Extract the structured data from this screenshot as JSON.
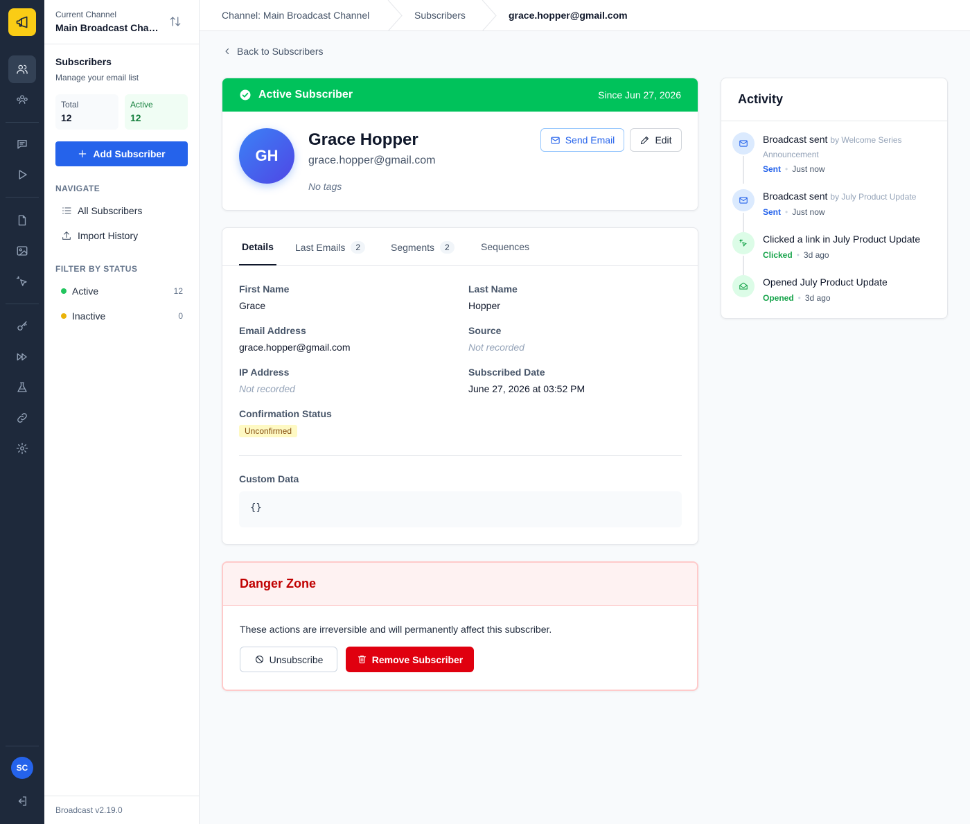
{
  "channel": {
    "label": "Current Channel",
    "name": "Main Broadcast Channel"
  },
  "sidebar": {
    "title": "Subscribers",
    "subtitle": "Manage your email list",
    "stats": {
      "total_label": "Total",
      "total_value": "12",
      "active_label": "Active",
      "active_value": "12"
    },
    "add_button": "Add Subscriber",
    "navigate_heading": "NAVIGATE",
    "nav": [
      {
        "label": "All Subscribers"
      },
      {
        "label": "Import History"
      }
    ],
    "filter_heading": "FILTER BY STATUS",
    "filters": [
      {
        "label": "Active",
        "count": "12",
        "color": "#22c55e"
      },
      {
        "label": "Inactive",
        "count": "0",
        "color": "#eab308"
      }
    ],
    "version": "Broadcast v2.19.0"
  },
  "rail": {
    "user_initials": "SC"
  },
  "breadcrumb": [
    "Channel: Main Broadcast Channel",
    "Subscribers",
    "grace.hopper@gmail.com"
  ],
  "back_link": "Back to Subscribers",
  "profile": {
    "status": "Active Subscriber",
    "since": "Since Jun 27, 2026",
    "initials": "GH",
    "name": "Grace Hopper",
    "email": "grace.hopper@gmail.com",
    "tags": "No tags",
    "send_email_label": "Send Email",
    "edit_label": "Edit",
    "status_color": "#00c25b"
  },
  "tabs": [
    {
      "label": "Details"
    },
    {
      "label": "Last Emails",
      "badge": "2"
    },
    {
      "label": "Segments",
      "badge": "2"
    },
    {
      "label": "Sequences"
    }
  ],
  "details": {
    "first_name_label": "First Name",
    "first_name": "Grace",
    "last_name_label": "Last Name",
    "last_name": "Hopper",
    "email_label": "Email Address",
    "email": "grace.hopper@gmail.com",
    "source_label": "Source",
    "source": "Not recorded",
    "ip_label": "IP Address",
    "ip": "Not recorded",
    "subscribed_label": "Subscribed Date",
    "subscribed": "June 27, 2026 at 03:52 PM",
    "confirmation_label": "Confirmation Status",
    "confirmation": "Unconfirmed",
    "custom_label": "Custom Data",
    "custom": "{}"
  },
  "danger": {
    "title": "Danger Zone",
    "message": "These actions are irreversible and will permanently affect this subscriber.",
    "unsubscribe_label": "Unsubscribe",
    "remove_label": "Remove Subscriber"
  },
  "activity": {
    "title": "Activity",
    "items": [
      {
        "title": "Broadcast sent",
        "by": "by Welcome Series Announcement",
        "status": "Sent",
        "time": "Just now",
        "icon": "mail-icon"
      },
      {
        "title": "Broadcast sent",
        "by": "by July Product Update",
        "status": "Sent",
        "time": "Just now",
        "icon": "mail-icon"
      },
      {
        "title": "Clicked a link in July Product Update",
        "status": "Clicked",
        "time": "3d ago",
        "icon": "click-icon"
      },
      {
        "title": "Opened July Product Update",
        "status": "Opened",
        "time": "3d ago",
        "icon": "mail-open-icon"
      }
    ]
  }
}
